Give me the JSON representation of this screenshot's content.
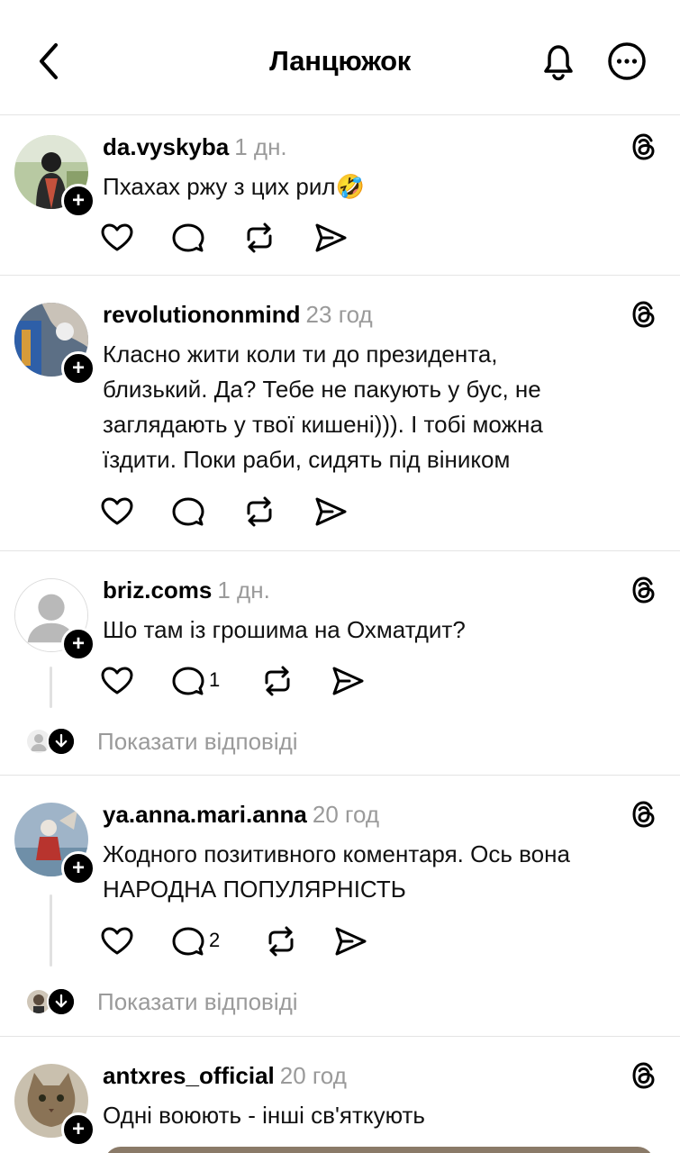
{
  "header": {
    "title": "Ланцюжок",
    "back_icon": "chevron-left-icon",
    "bell_icon": "bell-icon",
    "more_icon": "more-horizontal-icon"
  },
  "posts": [
    {
      "username": "da.vyskyba",
      "time": "1 дн.",
      "text": "Пхахах ржу з цих рил🤣",
      "reply_count": "",
      "show_replies": ""
    },
    {
      "username": "revolutiononmind",
      "time": "23 год",
      "text": "Класно жити коли ти до президента, близький. Да? Тебе не пакують у бус, не заглядають у твої кишені))). І тобі можна їздити. Поки раби, сидять під віником",
      "reply_count": "",
      "show_replies": ""
    },
    {
      "username": "briz.coms",
      "time": "1 дн.",
      "text": "Шо там із грошима на Охматдит?",
      "reply_count": "1",
      "show_replies": "Показати відповіді"
    },
    {
      "username": "ya.anna.mari.anna",
      "time": "20 год",
      "text": "Жодного позитивного коментаря. Ось вона НАРОДНА ПОПУЛЯРНІСТЬ",
      "reply_count": "2",
      "show_replies": "Показати відповіді"
    },
    {
      "username": "antxres_official",
      "time": "20 год",
      "text": "Одні воюють - інші св'яткують",
      "reply_count": "",
      "show_replies": ""
    }
  ],
  "icons": {
    "like": "heart-icon",
    "reply": "comment-icon",
    "repost": "repost-icon",
    "share": "send-icon",
    "threads": "threads-logo-icon",
    "follow": "plus-icon",
    "expand": "arrow-down-icon"
  },
  "colors": {
    "text": "#000000",
    "muted": "#9a9a9a",
    "divider": "#e4e4e4"
  }
}
